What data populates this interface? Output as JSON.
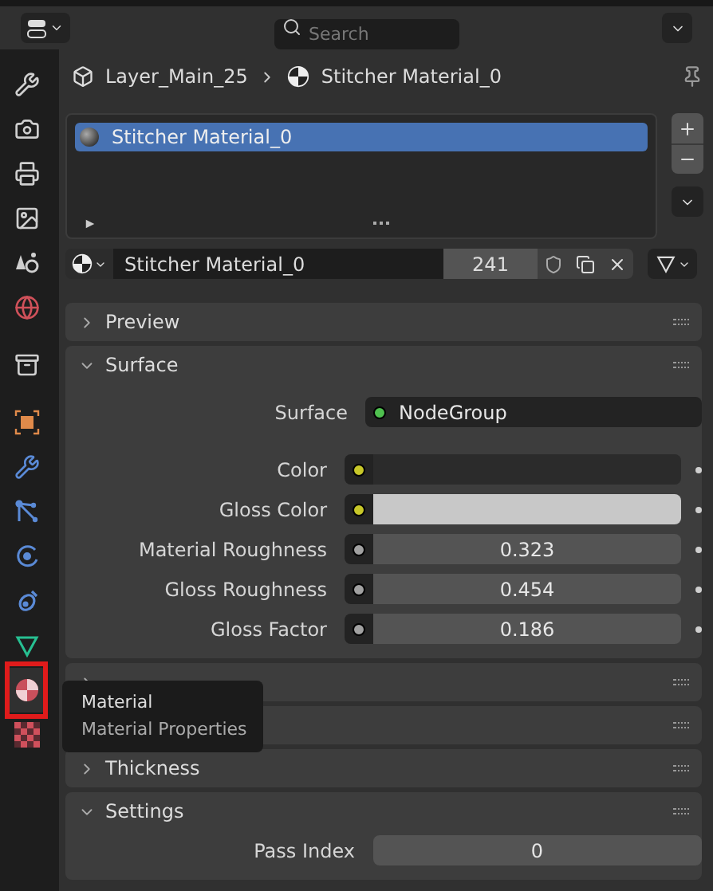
{
  "header": {
    "search": {
      "placeholder": "Search"
    }
  },
  "sidebar": {
    "items": [
      {
        "kind": "tool",
        "selected": false,
        "highlighted": false
      },
      {
        "kind": "render",
        "selected": false,
        "highlighted": false
      },
      {
        "kind": "output",
        "selected": false,
        "highlighted": false
      },
      {
        "kind": "view_layer",
        "selected": false,
        "highlighted": false
      },
      {
        "kind": "scene",
        "selected": false,
        "highlighted": false
      },
      {
        "kind": "world",
        "selected": false,
        "highlighted": false
      },
      {
        "kind": "collection",
        "selected": false,
        "highlighted": false
      },
      {
        "kind": "object",
        "selected": false,
        "highlighted": false
      },
      {
        "kind": "modifier",
        "selected": false,
        "highlighted": false
      },
      {
        "kind": "particles",
        "selected": false,
        "highlighted": false
      },
      {
        "kind": "physics",
        "selected": false,
        "highlighted": false
      },
      {
        "kind": "constraint",
        "selected": false,
        "highlighted": false
      },
      {
        "kind": "data",
        "selected": false,
        "highlighted": false
      },
      {
        "kind": "material",
        "selected": true,
        "highlighted": true
      },
      {
        "kind": "texture",
        "selected": false,
        "highlighted": false
      }
    ]
  },
  "breadcrumb": {
    "object": "Layer_Main_25",
    "material": "Stitcher Material_0"
  },
  "slots": [
    {
      "name": "Stitcher Material_0",
      "selected": true
    }
  ],
  "material_selector": {
    "name": "Stitcher Material_0",
    "users": "241"
  },
  "panels": [
    {
      "title": "Preview",
      "expanded": false
    },
    {
      "title": "Surface",
      "expanded": true,
      "rows": [
        {
          "kind": "shader",
          "label": "Surface",
          "value": "NodeGroup"
        },
        {
          "kind": "color",
          "label": "Color",
          "color": "#2b2b2b"
        },
        {
          "kind": "color",
          "label": "Gloss Color",
          "color": "#c8c8c8"
        },
        {
          "kind": "float",
          "label": "Material Roughness",
          "value": "0.323"
        },
        {
          "kind": "float",
          "label": "Gloss Roughness",
          "value": "0.454"
        },
        {
          "kind": "float",
          "label": "Gloss Factor",
          "value": "0.186"
        }
      ]
    },
    {
      "expanded": false,
      "chevron_shown": true
    },
    {
      "expanded": false
    },
    {
      "title": "Thickness",
      "expanded": false
    },
    {
      "title": "Settings",
      "expanded": true,
      "rows": [
        {
          "kind": "int",
          "label": "Pass Index",
          "value": "0"
        }
      ]
    }
  ],
  "tooltip": {
    "title": "Material",
    "description": "Material Properties"
  }
}
